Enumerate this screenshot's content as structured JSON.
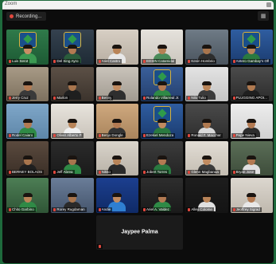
{
  "window": {
    "title": "Zoom"
  },
  "recording": {
    "label": "Recording..."
  },
  "participants": [
    {
      "name": "Luis Serot",
      "bg1": "#2f7a4a",
      "bg2": "#1d5a34",
      "skin": "#c98e64",
      "shirt": "#3b9a52",
      "logo": true
    },
    {
      "name": "Del Sing Ayro",
      "bg1": "#35424f",
      "bg2": "#1e2a35",
      "skin": "#b37a52",
      "shirt": "#2a5d3c",
      "logo": true
    },
    {
      "name": "Ariel Castro",
      "bg1": "#d7cfc4",
      "bg2": "#b8aea2",
      "skin": "#b98458",
      "shirt": "#e8e8e8"
    },
    {
      "name": "EDSIN Catamidal",
      "bg1": "#e5e2dc",
      "bg2": "#cbc6be",
      "skin": "#b58054",
      "shirt": "#4a8c5a"
    },
    {
      "name": "Kevin Hombrio",
      "bg1": "#6f7b86",
      "bg2": "#4a545e",
      "skin": "#a8754d",
      "shirt": "#2d2d2d"
    },
    {
      "name": "Antero Gambay's Office",
      "bg1": "#2f5da0",
      "bg2": "#1b3c70",
      "skin": "#b98458",
      "shirt": "#2a7a40",
      "logo": true
    },
    {
      "name": "Jerry Cruz",
      "bg1": "#a89a86",
      "bg2": "#7d705e",
      "skin": "#b37a52",
      "shirt": "#3a3a3a"
    },
    {
      "name": "Marlon",
      "bg1": "#5c5046",
      "bg2": "#3b332c",
      "skin": "#a8754d",
      "shirt": "#1f1f1f"
    },
    {
      "name": "Benny",
      "bg1": "#c9c3ba",
      "bg2": "#a19a90",
      "skin": "#c18b60",
      "shirt": "#2e2e2e"
    },
    {
      "name": "Rolando Villarreal Jr.",
      "bg1": "#3a5f9a",
      "bg2": "#243f6c",
      "skin": "#b37a52",
      "shirt": "#2f8a46",
      "logo": true
    },
    {
      "name": "Nilo Tulio",
      "bg1": "#e3e3e3",
      "bg2": "#c4c4c4",
      "skin": "#b98458",
      "shirt": "#3b3b3b"
    },
    {
      "name": "PLUGGING APOI...",
      "bg1": "#4b4b4b",
      "bg2": "#2c2c2c",
      "skin": "#b07a50",
      "shirt": "#1f1f1f"
    },
    {
      "name": "Rodel Caiaro",
      "bg1": "#7fa7c9",
      "bg2": "#5e86a8",
      "skin": "#b37a52",
      "shirt": "#2f8a46"
    },
    {
      "name": "Oliver Alberto P.",
      "bg1": "#e8e4dd",
      "bg2": "#c9c3ba",
      "skin": "#b98458",
      "shirt": "#f0f0f0"
    },
    {
      "name": "Benjo Dongle",
      "bg1": "#cfa97f",
      "bg2": "#a9845c",
      "skin": "#b37a52",
      "shirt": "#333"
    },
    {
      "name": "Ezekiel Mendoza",
      "bg1": "#2f5da0",
      "bg2": "#1b3c70",
      "skin": "#c18b60",
      "shirt": "#2a7a40",
      "logo": true
    },
    {
      "name": "Ronald F. Macchar",
      "bg1": "#4a4a4a",
      "bg2": "#2e2e2e",
      "skin": "#b07a50",
      "shirt": "#d9d9d9"
    },
    {
      "name": "Pepe Nieva",
      "bg1": "#ededed",
      "bg2": "#d2d2d2",
      "skin": "#b37a52",
      "shirt": "#2d2d2d"
    },
    {
      "name": "BERNEY BOLAOS",
      "bg1": "#5a4a3e",
      "bg2": "#3b2f27",
      "skin": "#a8754d",
      "shirt": "#1f1f1f"
    },
    {
      "name": "Jeff Abrea",
      "bg1": "#2b2b2b",
      "bg2": "#1a1a1a",
      "skin": "#a8754d",
      "shirt": "#2f8a46"
    },
    {
      "name": "Nikko",
      "bg1": "#d9d4cb",
      "bg2": "#b8b1a6",
      "skin": "#b98458",
      "shirt": "#2a2a2a"
    },
    {
      "name": "Jobert Torres",
      "bg1": "#3c3c3c",
      "bg2": "#242424",
      "skin": "#b37a52",
      "shirt": "#2a7a40"
    },
    {
      "name": "Glenn Magbanua",
      "bg1": "#e2ddd5",
      "bg2": "#c4bdb2",
      "skin": "#c18b60",
      "shirt": "#3b3b3b"
    },
    {
      "name": "Bryan Jose",
      "bg1": "#5b6e57",
      "bg2": "#3e4d3b",
      "skin": "#b37a52",
      "shirt": "#e0e0e0"
    },
    {
      "name": "Chito Garbino",
      "bg1": "#4d7e55",
      "bg2": "#2f5536",
      "skin": "#b98458",
      "shirt": "#2f8a46"
    },
    {
      "name": "Rorey Rugdaman",
      "bg1": "#6a7d99",
      "bg2": "#45556c",
      "skin": "#a8754d",
      "shirt": "#2a2a2a"
    },
    {
      "name": "Andie",
      "bg1": "#1c3f8f",
      "bg2": "#0f2a66",
      "skin": "#c18b60",
      "shirt": "#2f7fd1"
    },
    {
      "name": "Ariel A. Valdez",
      "bg1": "#2e2e2e",
      "bg2": "#1a1a1a",
      "skin": "#b37a52",
      "shirt": "#2f8a46"
    },
    {
      "name": "Alley Colome",
      "bg1": "#1d1d1d",
      "bg2": "#141414",
      "skin": "#b98458",
      "shirt": "#e0e0e0"
    },
    {
      "name": "Jeoffrey Sigrad",
      "bg1": "#dcd7cf",
      "bg2": "#bfb8ad",
      "skin": "#b37a52",
      "shirt": "#e8e8e8"
    }
  ],
  "featured": {
    "name": "Jaypee Palma"
  }
}
